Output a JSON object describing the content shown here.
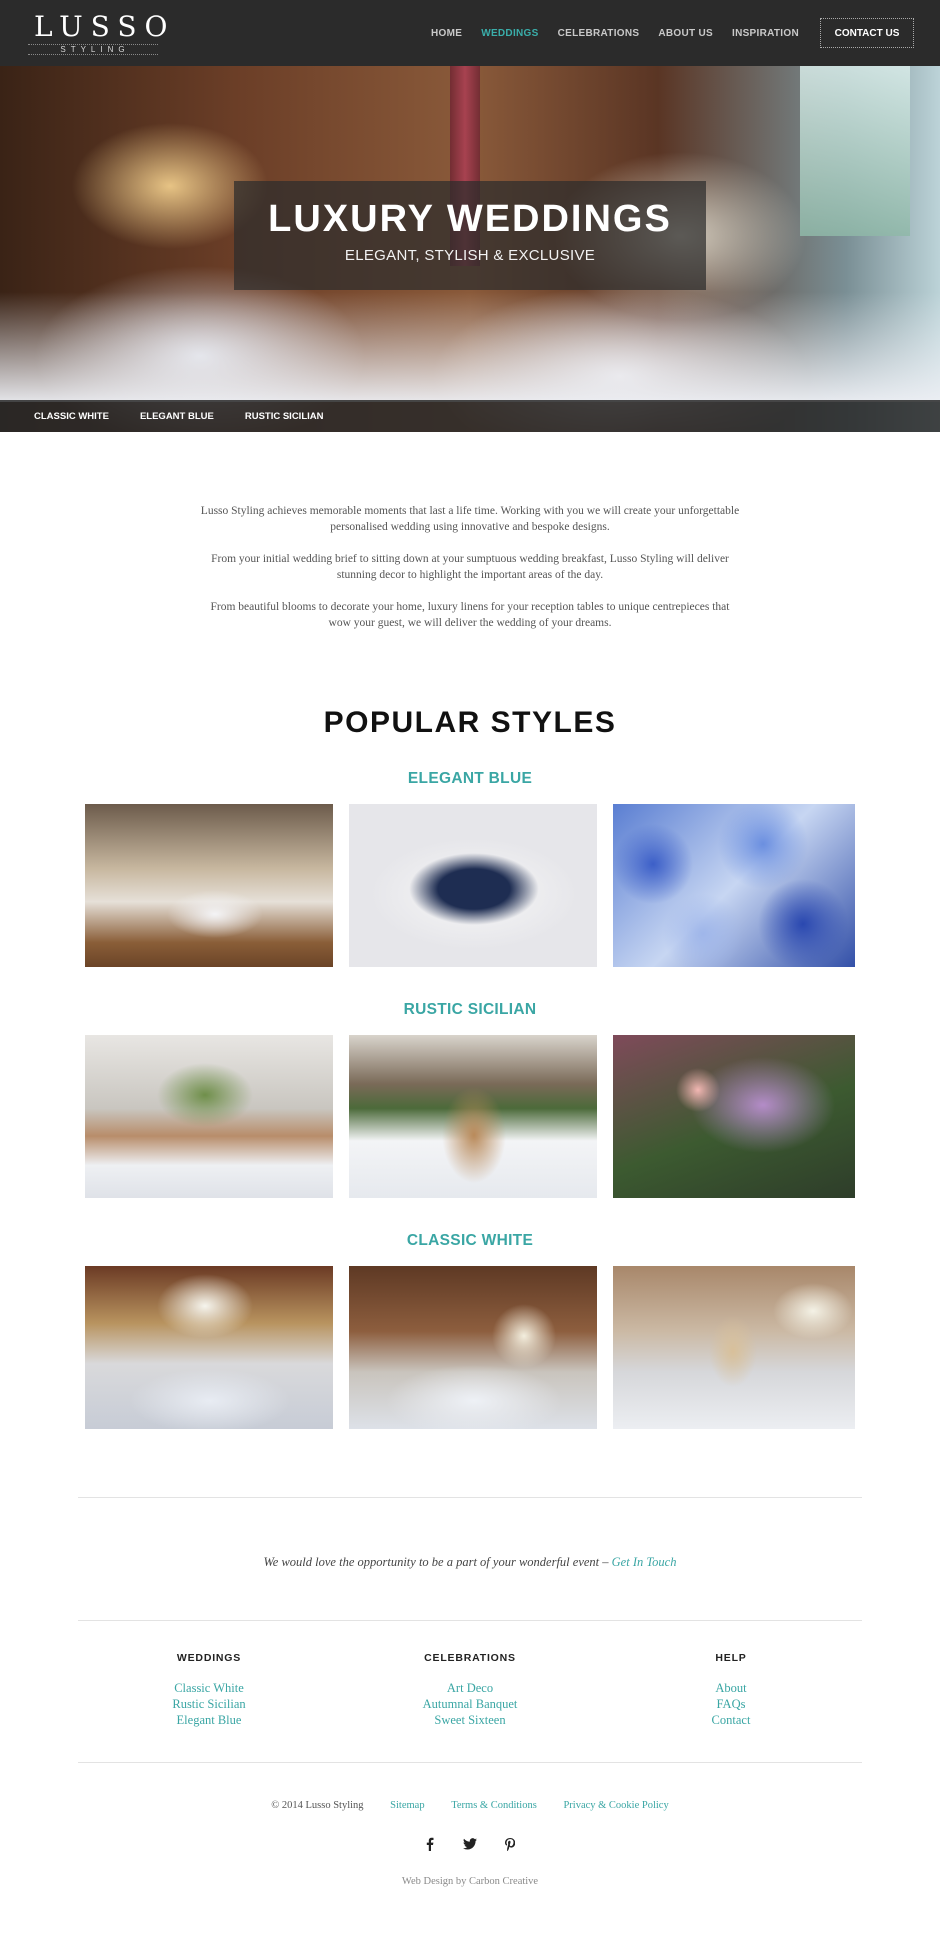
{
  "brand": {
    "name": "LUSSO",
    "tagline": "STYLING"
  },
  "nav": {
    "items": [
      {
        "label": "HOME"
      },
      {
        "label": "WEDDINGS"
      },
      {
        "label": "CELEBRATIONS"
      },
      {
        "label": "ABOUT US"
      },
      {
        "label": "INSPIRATION"
      }
    ],
    "active": "WEDDINGS",
    "contact_label": "CONTACT US"
  },
  "hero": {
    "title": "LUXURY WEDDINGS",
    "subtitle": "ELEGANT, STYLISH & EXCLUSIVE",
    "style_links": [
      "CLASSIC WHITE",
      "ELEGANT BLUE",
      "RUSTIC SICILIAN"
    ]
  },
  "intro": {
    "paragraphs": [
      "Lusso Styling achieves memorable moments that last a life time. Working with you we will create your unforgettable personalised wedding using innovative and bespoke designs.",
      "From your initial wedding brief to sitting down at your sumptuous wedding breakfast, Lusso Styling will deliver stunning decor to highlight the important areas of the day.",
      "From beautiful blooms to decorate your home, luxury linens for your reception tables to unique centrepieces that wow your guest, we will deliver the wedding of your dreams."
    ]
  },
  "popular": {
    "title": "POPULAR STYLES",
    "styles": [
      {
        "name": "ELEGANT BLUE"
      },
      {
        "name": "RUSTIC SICILIAN"
      },
      {
        "name": "CLASSIC WHITE"
      }
    ]
  },
  "cta": {
    "text": "We would love the opportunity to be a part of your wonderful event – ",
    "link": "Get In Touch"
  },
  "footer": {
    "columns": [
      {
        "heading": "WEDDINGS",
        "links": [
          "Classic White",
          "Rustic Sicilian",
          "Elegant Blue"
        ]
      },
      {
        "heading": "CELEBRATIONS",
        "links": [
          "Art Deco",
          "Autumnal Banquet",
          "Sweet Sixteen"
        ]
      },
      {
        "heading": "HELP",
        "links": [
          "About",
          "FAQs",
          "Contact"
        ]
      }
    ],
    "copyright": "© 2014 Lusso Styling",
    "legal_links": [
      "Sitemap",
      "Terms & Conditions",
      "Privacy & Cookie Policy"
    ],
    "social": [
      "facebook-icon",
      "twitter-icon",
      "pinterest-icon"
    ],
    "credit": "Web Design by Carbon Creative"
  },
  "colors": {
    "accent": "#3aa6a4",
    "header_bg": "#2b2b2b",
    "text": "#333333"
  }
}
